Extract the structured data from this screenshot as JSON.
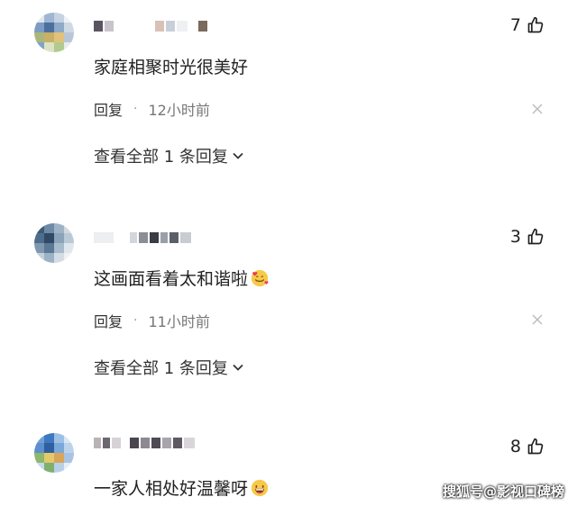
{
  "comments": [
    {
      "text": "家庭相聚时光很美好",
      "likes": "7",
      "reply_label": "回复",
      "time": "12小时前",
      "view_replies": "查看全部 1 条回复"
    },
    {
      "text": "这画面看着太和谐啦",
      "likes": "3",
      "reply_label": "回复",
      "time": "11小时前",
      "view_replies": "查看全部 1 条回复",
      "emoji": "smiling-face-with-hearts-icon"
    },
    {
      "text": "一家人相处好温馨呀",
      "likes": "8",
      "emoji": "grinning-face-icon"
    }
  ],
  "watermark": "搜狐号@影视口碑榜",
  "colors": {
    "text": "#222222",
    "meta": "#777777",
    "background": "#ffffff"
  }
}
